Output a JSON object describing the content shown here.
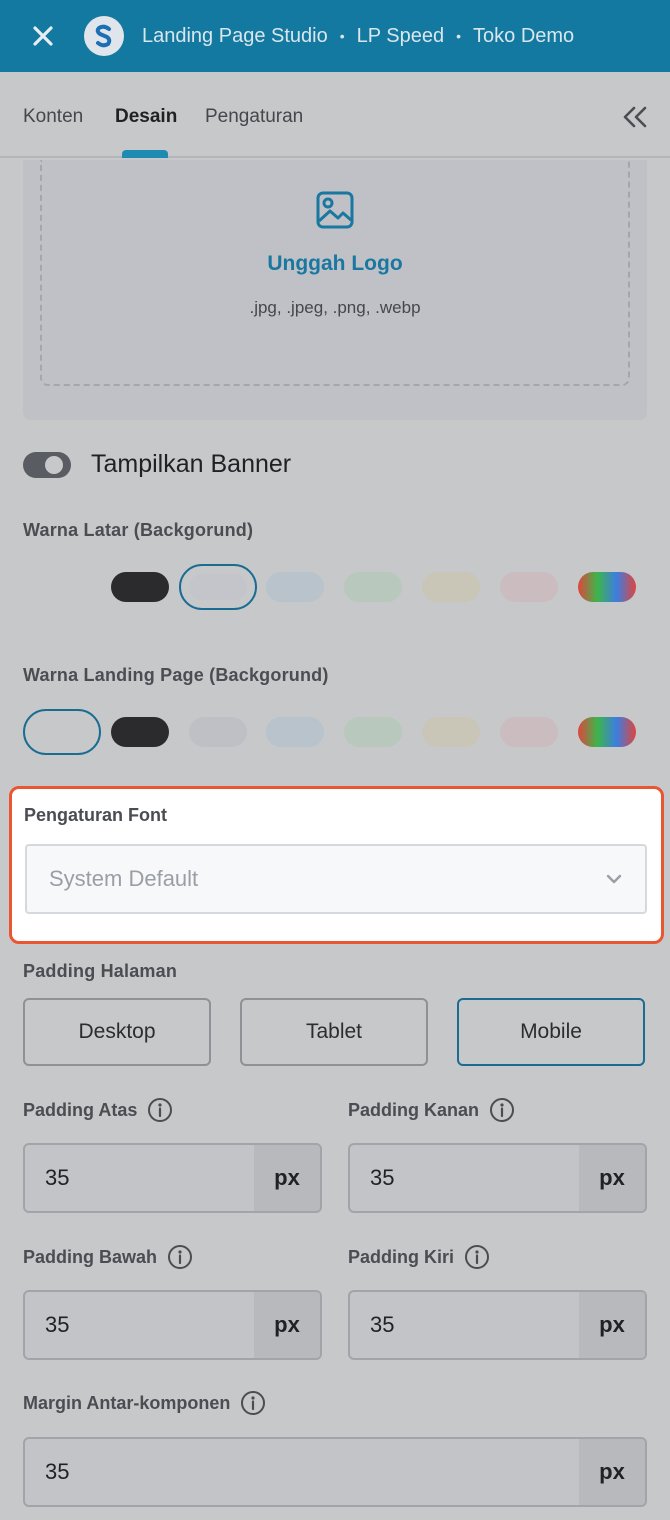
{
  "header": {
    "breadcrumbs": [
      "Landing Page Studio",
      "LP Speed",
      "Toko Demo"
    ],
    "separator": "•"
  },
  "tabs": [
    {
      "label": "Konten",
      "active": false
    },
    {
      "label": "Desain",
      "active": true
    },
    {
      "label": "Pengaturan",
      "active": false
    }
  ],
  "upload": {
    "label": "Unggah Logo",
    "hint": ".jpg, .jpeg, .png, .webp"
  },
  "banner_toggle": {
    "label": "Tampilkan Banner",
    "on": false
  },
  "background_color": {
    "label": "Warna Latar (Backgorund)",
    "swatches": [
      "#2b2b2d",
      "#c3c5ca",
      "#b8c3cb",
      "#b8c8bd",
      "#c9c6b7",
      "#cbbcc0",
      "gradient"
    ],
    "selected_index": 1
  },
  "landing_color": {
    "label": "Warna Landing Page (Backgorund)",
    "swatches": [
      "#c7c8ca",
      "#2b2b2d",
      "#bfc0c5",
      "#b8c3cb",
      "#b8c8bd",
      "#c9c6b7",
      "#cbbcc0",
      "gradient"
    ],
    "selected_index": 0
  },
  "font_settings": {
    "label": "Pengaturan Font",
    "value": "System Default"
  },
  "padding": {
    "label": "Padding Halaman",
    "devices": [
      {
        "label": "Desktop",
        "active": false
      },
      {
        "label": "Tablet",
        "active": false
      },
      {
        "label": "Mobile",
        "active": true
      }
    ],
    "top": {
      "label": "Padding Atas",
      "value": "35",
      "unit": "px"
    },
    "right": {
      "label": "Padding Kanan",
      "value": "35",
      "unit": "px"
    },
    "bottom": {
      "label": "Padding Bawah",
      "value": "35",
      "unit": "px"
    },
    "left": {
      "label": "Padding Kiri",
      "value": "35",
      "unit": "px"
    }
  },
  "margin": {
    "label": "Margin Antar-komponen",
    "value": "35",
    "unit": "px"
  },
  "colors": {
    "header": "#1479a0",
    "accent": "#1a78a0",
    "highlight_border": "#ea5532"
  }
}
